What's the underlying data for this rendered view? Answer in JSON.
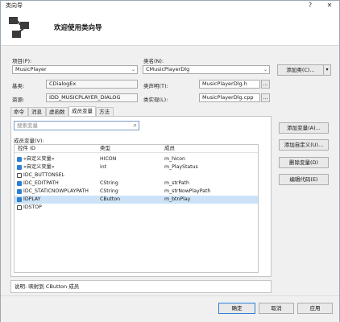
{
  "window": {
    "title": "类向导",
    "help": "?",
    "close": "✕",
    "heading": "欢迎使用类向导"
  },
  "form": {
    "project_label": "项目(P):",
    "project_value": "MusicPlayer",
    "classname_label": "类名(N):",
    "classname_value": "CMusicPlayerDlg",
    "add_class_label": "添加类(C)...",
    "base_label": "基类:",
    "base_value": "CDialogEx",
    "declare_label": "类声明(T):",
    "declare_value": "MusicPlayerDlg.h",
    "resource_label": "资源:",
    "resource_value": "IDD_MUSICPLAYER_DIALOG",
    "impl_label": "类实现(L):",
    "impl_value": "MusicPlayerDlg.cpp"
  },
  "tabs": [
    {
      "label": "命令"
    },
    {
      "label": "消息"
    },
    {
      "label": "虚函数"
    },
    {
      "label": "成员变量"
    },
    {
      "label": "方法"
    }
  ],
  "search": {
    "placeholder": "搜索变量"
  },
  "members": {
    "label": "成员变量(V):",
    "col_id": "控件 ID",
    "col_type": "类型",
    "col_member": "成员",
    "rows": [
      {
        "id": "«自定义变量»",
        "type": "HICON",
        "member": "m_hIcon",
        "icon": "var-icon"
      },
      {
        "id": "«自定义变量»",
        "type": "int",
        "member": "m_PlayStatus",
        "icon": "var-icon"
      },
      {
        "id": "IDC_BUTTONSEL",
        "type": "",
        "member": "",
        "icon": "control-icon"
      },
      {
        "id": "IDC_EDITPATH",
        "type": "CString",
        "member": "m_strPath",
        "icon": "control-icon"
      },
      {
        "id": "IDC_STATICNOWPLAYPATH",
        "type": "CString",
        "member": "m_strNowPlayPath",
        "icon": "control-icon"
      },
      {
        "id": "IDPLAY",
        "type": "CButton",
        "member": "m_btnPlay",
        "icon": "control-icon"
      },
      {
        "id": "IDSTOP",
        "type": "",
        "member": "",
        "icon": "control-icon"
      }
    ]
  },
  "side_buttons": {
    "add_var": "添加变量(A)...",
    "add_custom": "添加自定义(U)...",
    "delete_var": "删除变量(D)",
    "edit_code": "编辑代码(E)"
  },
  "status": "说明: 映射到 CButton 成员",
  "footer": {
    "ok": "确定",
    "cancel": "取消",
    "apply": "应用"
  },
  "colors": {
    "accent": "#2d7fd3",
    "selection": "#cce3f7"
  }
}
